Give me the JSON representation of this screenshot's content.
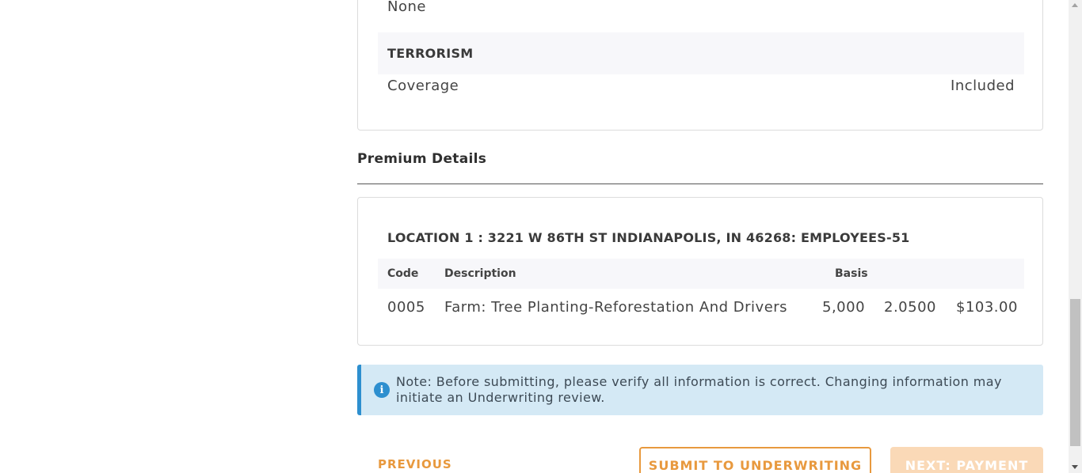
{
  "coverage": {
    "previous_value": "None",
    "section_title": "TERRORISM",
    "coverage_label": "Coverage",
    "coverage_value": "Included"
  },
  "premium": {
    "heading": "Premium Details",
    "location_title": "LOCATION 1 : 3221 W 86TH ST INDIANAPOLIS, IN 46268: EMPLOYEES-51",
    "columns": {
      "code": "Code",
      "description": "Description",
      "basis": "Basis"
    },
    "rows": [
      {
        "code": "0005",
        "description": "Farm: Tree Planting-Reforestation And Drivers",
        "basis": "5,000",
        "rate": "2.0500",
        "premium": "$103.00"
      }
    ]
  },
  "note": {
    "text": "Note: Before submitting, please verify all information is correct. Changing information may initiate an Underwriting review."
  },
  "actions": {
    "previous_label": "PREVIOUS",
    "submit_label": "SUBMIT TO UNDERWRITING",
    "next_label": "NEXT: PAYMENT"
  },
  "colors": {
    "accent": "#e8993e",
    "accent_disabled": "#fad9b7",
    "info": "#2d8fcf",
    "info_bg": "#d4e9f5"
  }
}
